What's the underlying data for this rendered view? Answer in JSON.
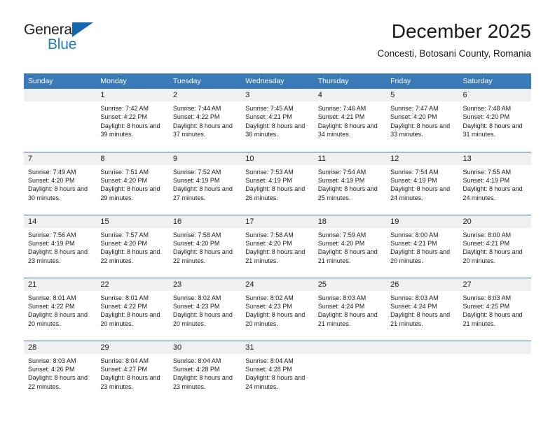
{
  "brand": {
    "name_top": "General",
    "name_bottom": "Blue",
    "triangle_color": "#1166ae",
    "blue_color": "#1f7ac4"
  },
  "header": {
    "title": "December 2025",
    "subtitle": "Concesti, Botosani County, Romania"
  },
  "theme": {
    "header_bg": "#3b7ab8",
    "daynum_bg": "#f0f0f0",
    "grid_line": "#3b7ab8",
    "text": "#1a1a1a"
  },
  "weekdays": [
    "Sunday",
    "Monday",
    "Tuesday",
    "Wednesday",
    "Thursday",
    "Friday",
    "Saturday"
  ],
  "weeks": [
    [
      {
        "day": "",
        "lines": []
      },
      {
        "day": "1",
        "lines": [
          "Sunrise: 7:42 AM",
          "Sunset: 4:22 PM",
          "Daylight: 8 hours and 39 minutes."
        ]
      },
      {
        "day": "2",
        "lines": [
          "Sunrise: 7:44 AM",
          "Sunset: 4:22 PM",
          "Daylight: 8 hours and 37 minutes."
        ]
      },
      {
        "day": "3",
        "lines": [
          "Sunrise: 7:45 AM",
          "Sunset: 4:21 PM",
          "Daylight: 8 hours and 36 minutes."
        ]
      },
      {
        "day": "4",
        "lines": [
          "Sunrise: 7:46 AM",
          "Sunset: 4:21 PM",
          "Daylight: 8 hours and 34 minutes."
        ]
      },
      {
        "day": "5",
        "lines": [
          "Sunrise: 7:47 AM",
          "Sunset: 4:20 PM",
          "Daylight: 8 hours and 33 minutes."
        ]
      },
      {
        "day": "6",
        "lines": [
          "Sunrise: 7:48 AM",
          "Sunset: 4:20 PM",
          "Daylight: 8 hours and 31 minutes."
        ]
      }
    ],
    [
      {
        "day": "7",
        "lines": [
          "Sunrise: 7:49 AM",
          "Sunset: 4:20 PM",
          "Daylight: 8 hours and 30 minutes."
        ]
      },
      {
        "day": "8",
        "lines": [
          "Sunrise: 7:51 AM",
          "Sunset: 4:20 PM",
          "Daylight: 8 hours and 29 minutes."
        ]
      },
      {
        "day": "9",
        "lines": [
          "Sunrise: 7:52 AM",
          "Sunset: 4:19 PM",
          "Daylight: 8 hours and 27 minutes."
        ]
      },
      {
        "day": "10",
        "lines": [
          "Sunrise: 7:53 AM",
          "Sunset: 4:19 PM",
          "Daylight: 8 hours and 26 minutes."
        ]
      },
      {
        "day": "11",
        "lines": [
          "Sunrise: 7:54 AM",
          "Sunset: 4:19 PM",
          "Daylight: 8 hours and 25 minutes."
        ]
      },
      {
        "day": "12",
        "lines": [
          "Sunrise: 7:54 AM",
          "Sunset: 4:19 PM",
          "Daylight: 8 hours and 24 minutes."
        ]
      },
      {
        "day": "13",
        "lines": [
          "Sunrise: 7:55 AM",
          "Sunset: 4:19 PM",
          "Daylight: 8 hours and 24 minutes."
        ]
      }
    ],
    [
      {
        "day": "14",
        "lines": [
          "Sunrise: 7:56 AM",
          "Sunset: 4:19 PM",
          "Daylight: 8 hours and 23 minutes."
        ]
      },
      {
        "day": "15",
        "lines": [
          "Sunrise: 7:57 AM",
          "Sunset: 4:20 PM",
          "Daylight: 8 hours and 22 minutes."
        ]
      },
      {
        "day": "16",
        "lines": [
          "Sunrise: 7:58 AM",
          "Sunset: 4:20 PM",
          "Daylight: 8 hours and 22 minutes."
        ]
      },
      {
        "day": "17",
        "lines": [
          "Sunrise: 7:58 AM",
          "Sunset: 4:20 PM",
          "Daylight: 8 hours and 21 minutes."
        ]
      },
      {
        "day": "18",
        "lines": [
          "Sunrise: 7:59 AM",
          "Sunset: 4:20 PM",
          "Daylight: 8 hours and 21 minutes."
        ]
      },
      {
        "day": "19",
        "lines": [
          "Sunrise: 8:00 AM",
          "Sunset: 4:21 PM",
          "Daylight: 8 hours and 20 minutes."
        ]
      },
      {
        "day": "20",
        "lines": [
          "Sunrise: 8:00 AM",
          "Sunset: 4:21 PM",
          "Daylight: 8 hours and 20 minutes."
        ]
      }
    ],
    [
      {
        "day": "21",
        "lines": [
          "Sunrise: 8:01 AM",
          "Sunset: 4:22 PM",
          "Daylight: 8 hours and 20 minutes."
        ]
      },
      {
        "day": "22",
        "lines": [
          "Sunrise: 8:01 AM",
          "Sunset: 4:22 PM",
          "Daylight: 8 hours and 20 minutes."
        ]
      },
      {
        "day": "23",
        "lines": [
          "Sunrise: 8:02 AM",
          "Sunset: 4:23 PM",
          "Daylight: 8 hours and 20 minutes."
        ]
      },
      {
        "day": "24",
        "lines": [
          "Sunrise: 8:02 AM",
          "Sunset: 4:23 PM",
          "Daylight: 8 hours and 20 minutes."
        ]
      },
      {
        "day": "25",
        "lines": [
          "Sunrise: 8:03 AM",
          "Sunset: 4:24 PM",
          "Daylight: 8 hours and 21 minutes."
        ]
      },
      {
        "day": "26",
        "lines": [
          "Sunrise: 8:03 AM",
          "Sunset: 4:24 PM",
          "Daylight: 8 hours and 21 minutes."
        ]
      },
      {
        "day": "27",
        "lines": [
          "Sunrise: 8:03 AM",
          "Sunset: 4:25 PM",
          "Daylight: 8 hours and 21 minutes."
        ]
      }
    ],
    [
      {
        "day": "28",
        "lines": [
          "Sunrise: 8:03 AM",
          "Sunset: 4:26 PM",
          "Daylight: 8 hours and 22 minutes."
        ]
      },
      {
        "day": "29",
        "lines": [
          "Sunrise: 8:04 AM",
          "Sunset: 4:27 PM",
          "Daylight: 8 hours and 23 minutes."
        ]
      },
      {
        "day": "30",
        "lines": [
          "Sunrise: 8:04 AM",
          "Sunset: 4:28 PM",
          "Daylight: 8 hours and 23 minutes."
        ]
      },
      {
        "day": "31",
        "lines": [
          "Sunrise: 8:04 AM",
          "Sunset: 4:28 PM",
          "Daylight: 8 hours and 24 minutes."
        ]
      },
      {
        "day": "",
        "lines": []
      },
      {
        "day": "",
        "lines": []
      },
      {
        "day": "",
        "lines": []
      }
    ]
  ]
}
